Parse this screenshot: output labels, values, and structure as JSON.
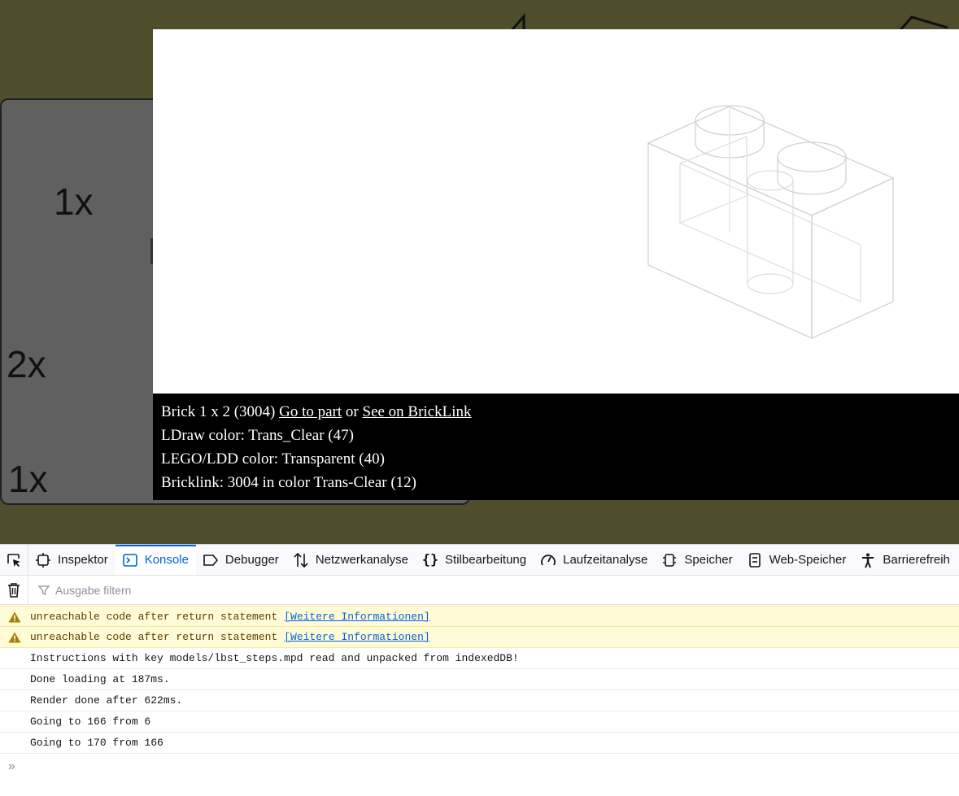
{
  "page": {
    "step_quantities": [
      "1x",
      "2x",
      "1x"
    ],
    "part_info": {
      "name": "Brick 1 x 2 (3004)",
      "go_to_part_link": "Go to part",
      "or_word": "or",
      "bricklink_link": "See on BrickLink",
      "ldraw_color": "LDraw color: Trans_Clear (47)",
      "lego_color": "LEGO/LDD color: Transparent (40)",
      "bricklink": "Bricklink: 3004 in color Trans-Clear (12)"
    }
  },
  "devtools": {
    "tabs": [
      {
        "label": "Inspektor",
        "icon": "inspector-icon"
      },
      {
        "label": "Konsole",
        "icon": "console-icon",
        "active": true
      },
      {
        "label": "Debugger",
        "icon": "debugger-icon"
      },
      {
        "label": "Netzwerkanalyse",
        "icon": "network-icon"
      },
      {
        "label": "Stilbearbeitung",
        "icon": "style-editor-icon"
      },
      {
        "label": "Laufzeitanalyse",
        "icon": "performance-icon"
      },
      {
        "label": "Speicher",
        "icon": "memory-icon"
      },
      {
        "label": "Web-Speicher",
        "icon": "storage-icon"
      },
      {
        "label": "Barrierefreih",
        "icon": "accessibility-icon"
      }
    ],
    "filter_placeholder": "Ausgabe filtern",
    "messages": [
      {
        "type": "warning",
        "text": "unreachable code after return statement",
        "link": "[Weitere Informationen]"
      },
      {
        "type": "warning",
        "text": "unreachable code after return statement",
        "link": "[Weitere Informationen]"
      },
      {
        "type": "log",
        "text": "Instructions with key models/lbst_steps.mpd read and unpacked from indexedDB!"
      },
      {
        "type": "log",
        "text": "Done loading at 187ms."
      },
      {
        "type": "log",
        "text": "Render done after 622ms."
      },
      {
        "type": "log",
        "text": "Going to 166 from 6"
      },
      {
        "type": "log",
        "text": "Going to 170 from 166"
      }
    ],
    "prompt_symbol": "»"
  },
  "colors": {
    "page_background": "#4f4d2c",
    "step_panel": "#606060",
    "accent": "#0061e0",
    "warning_background": "#fffbd6"
  }
}
